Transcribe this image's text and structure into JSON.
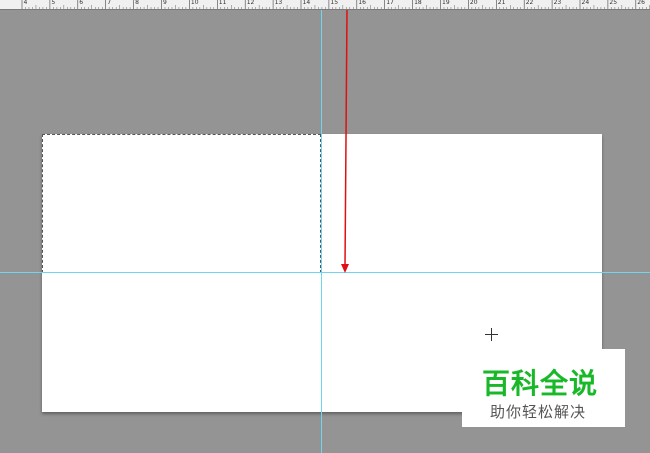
{
  "ruler": {
    "labels": [
      "4",
      "5",
      "6",
      "7",
      "8",
      "9",
      "10",
      "11",
      "12",
      "13",
      "14",
      "15",
      "16",
      "17",
      "18",
      "19",
      "20",
      "21",
      "22",
      "23",
      "24",
      "25",
      "26"
    ]
  },
  "watermark": {
    "title": "百科全说",
    "subtitle": "助你轻松解决"
  },
  "colors": {
    "workspace": "#949494",
    "guide": "#6fd6ee",
    "arrow": "#e01010",
    "brand": "#19b829"
  },
  "icons": {
    "cursor": "crosshair-icon",
    "arrow": "arrow-down-icon"
  }
}
